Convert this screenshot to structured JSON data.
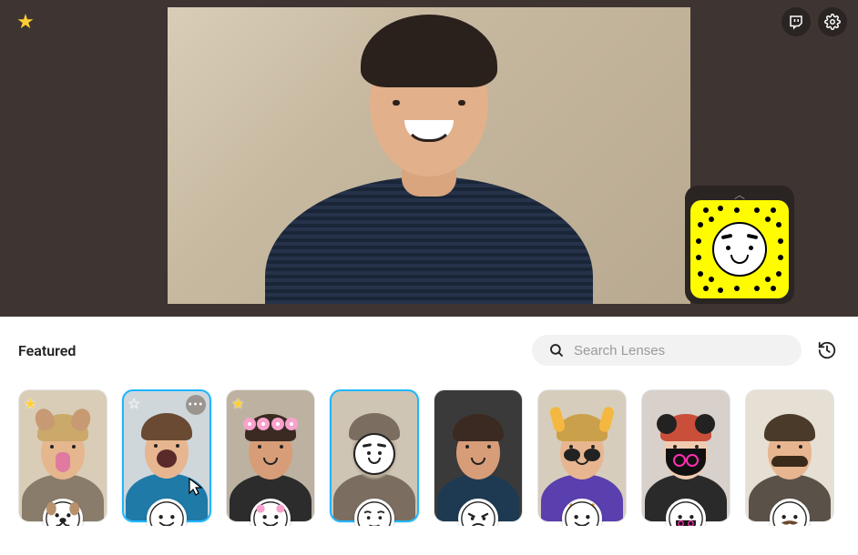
{
  "colors": {
    "accent": "#1FB6FF",
    "snap_yellow": "#FFFC00",
    "star_yellow": "#ffcf33"
  },
  "header": {
    "favorites_button": "favorites",
    "twitch_button": "twitch",
    "settings_button": "settings"
  },
  "snapcode": {
    "expand_label": "expand"
  },
  "panel": {
    "title": "Featured",
    "history_button": "history"
  },
  "search": {
    "placeholder": "Search Lenses",
    "value": ""
  },
  "lenses": [
    {
      "name": "dog",
      "favorited": true,
      "selected": false,
      "thumb_bg": "#d9cdb8",
      "shirt": "#8a7c6a",
      "skin": "#e6b68f",
      "hair": "#caa96a",
      "icon": "dog-face"
    },
    {
      "name": "big-mouth",
      "favorited": false,
      "selected": true,
      "thumb_bg": "#cfd7db",
      "shirt": "#1f7aa8",
      "skin": "#e7b690",
      "hair": "#6a4a33",
      "icon": "smile-face",
      "show_more": true
    },
    {
      "name": "flowers",
      "favorited": true,
      "selected": false,
      "thumb_bg": "#bdb2a1",
      "shirt": "#2c2c2c",
      "skin": "#d79d78",
      "hair": "#3a2a22",
      "icon": "rosie-face"
    },
    {
      "name": "no-face",
      "favorited": false,
      "selected": true,
      "thumb_bg": "#cfc5b5",
      "shirt": "#7b6e60",
      "skin": "#b9ab98",
      "hair": "#7b6e60",
      "icon": "blank-face"
    },
    {
      "name": "jaw",
      "favorited": false,
      "selected": false,
      "thumb_bg": "#3a3a3a",
      "shirt": "#1e3a52",
      "skin": "#d79d78",
      "hair": "#3a2a22",
      "icon": "angry-face"
    },
    {
      "name": "deer",
      "favorited": false,
      "selected": false,
      "thumb_bg": "#d7cdbc",
      "shirt": "#5a3fae",
      "skin": "#e7b690",
      "hair": "#caa14a",
      "icon": "deer-face"
    },
    {
      "name": "neon-mask",
      "favorited": false,
      "selected": false,
      "thumb_bg": "#d7d0cb",
      "shirt": "#2a2a2a",
      "skin": "#f0cbb0",
      "hair": "#c94f3a",
      "icon": "mask-face"
    },
    {
      "name": "mustache",
      "favorited": false,
      "selected": false,
      "thumb_bg": "#e6dfd4",
      "shirt": "#5a5248",
      "skin": "#e7b690",
      "hair": "#4a3a2a",
      "icon": "stache-face"
    }
  ]
}
